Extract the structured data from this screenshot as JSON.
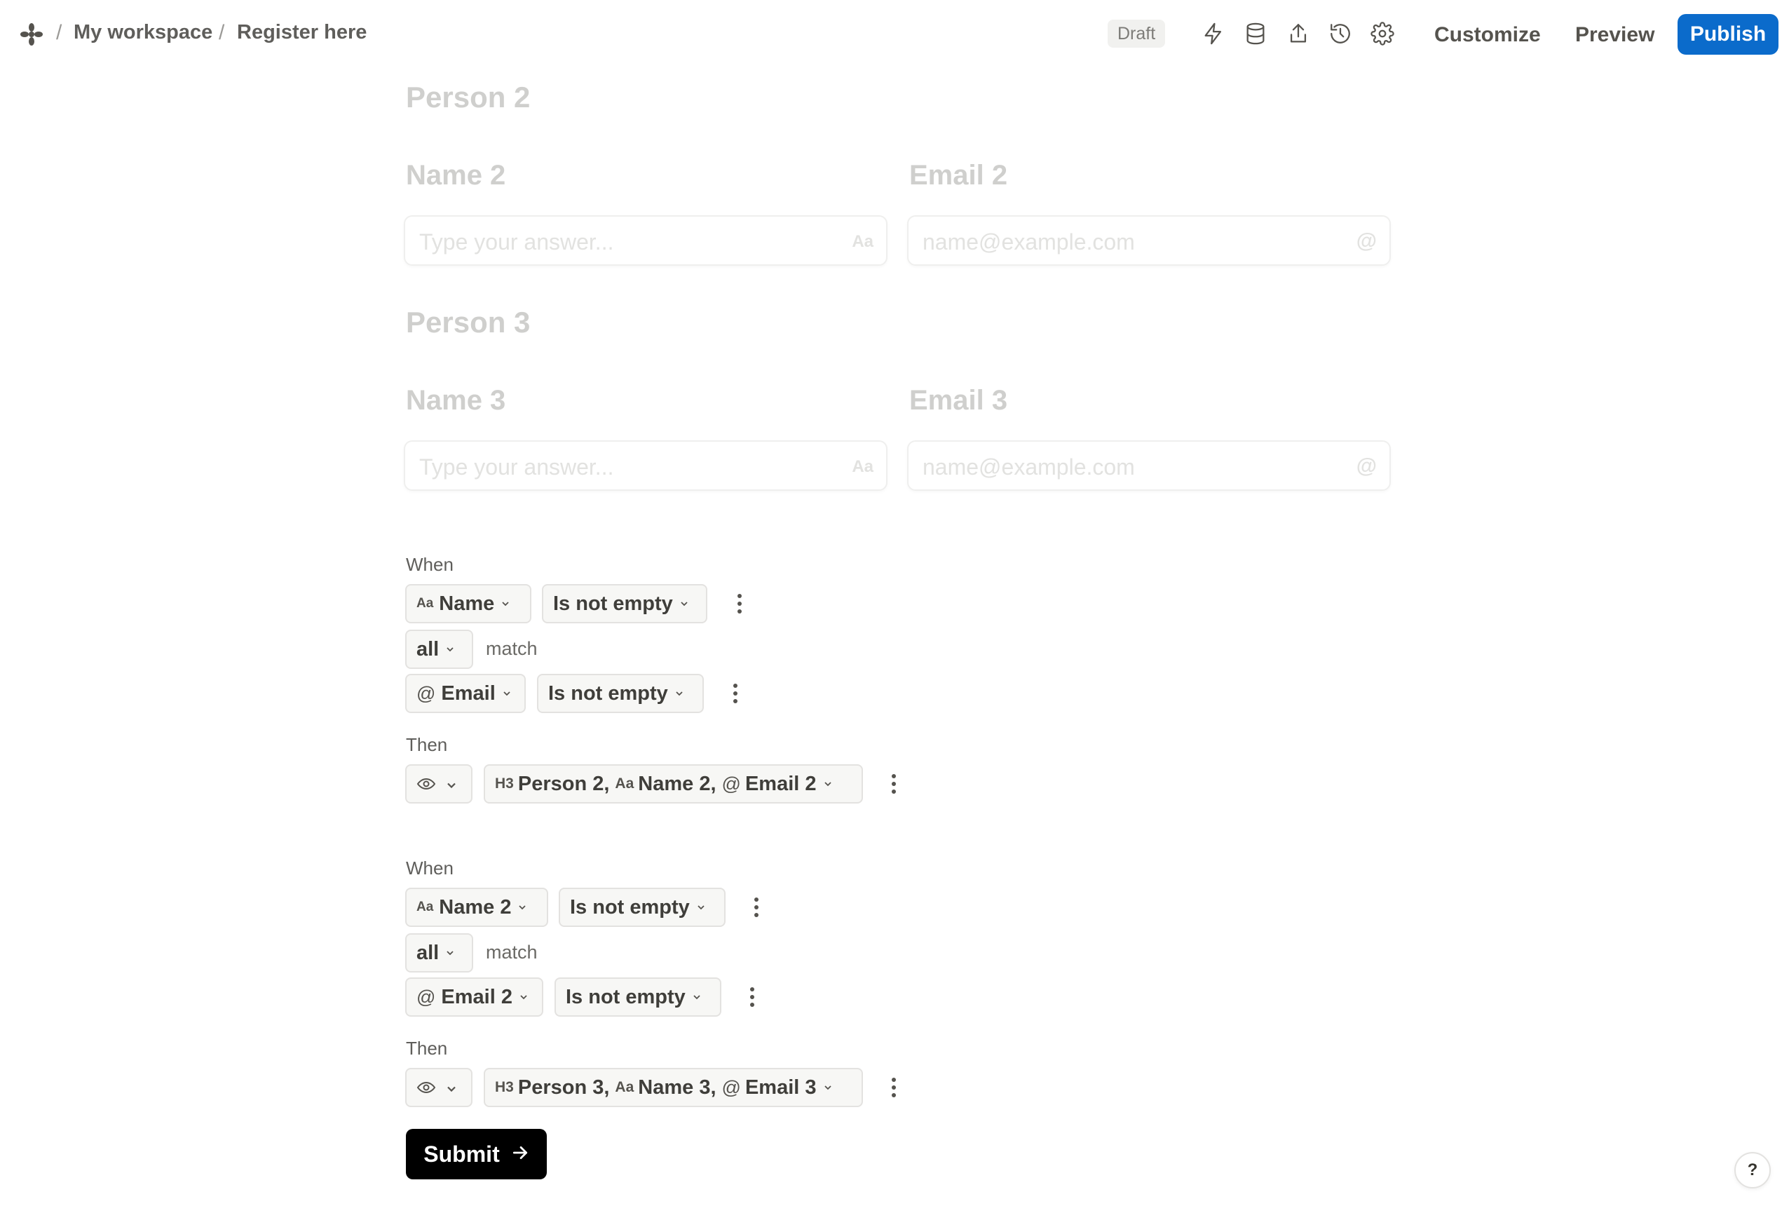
{
  "breadcrumb": {
    "workspace": "My workspace",
    "page": "Register here",
    "separator": "/"
  },
  "toolbar": {
    "status_badge": "Draft",
    "icons": [
      "lightning-icon",
      "database-icon",
      "share-icon",
      "history-icon",
      "settings-icon"
    ],
    "customize_label": "Customize",
    "preview_label": "Preview",
    "publish_label": "Publish",
    "accent_color": "#0b6bcb"
  },
  "form": {
    "sections": [
      {
        "heading": "Person 2",
        "name_label": "Name 2",
        "name_placeholder": "Type your answer...",
        "email_label": "Email 2",
        "email_placeholder": "name@example.com"
      },
      {
        "heading": "Person 3",
        "name_label": "Name 3",
        "name_placeholder": "Type your answer...",
        "email_label": "Email 3",
        "email_placeholder": "name@example.com"
      }
    ],
    "text_suffix": "Aa",
    "email_suffix": "@"
  },
  "logic": [
    {
      "when_label": "When",
      "condition1": {
        "field": "Name",
        "operator": "Is not empty"
      },
      "match_mode": "all",
      "match_text": "match",
      "condition2": {
        "field": "Email",
        "operator": "Is not empty"
      },
      "then_label": "Then",
      "targets": {
        "heading": "Person 2,",
        "name": "Name 2,",
        "email": "Email 2"
      }
    },
    {
      "when_label": "When",
      "condition1": {
        "field": "Name 2",
        "operator": "Is not empty"
      },
      "match_mode": "all",
      "match_text": "match",
      "condition2": {
        "field": "Email 2",
        "operator": "Is not empty"
      },
      "then_label": "Then",
      "targets": {
        "heading": "Person 3,",
        "name": "Name 3,",
        "email": "Email 3"
      }
    }
  ],
  "field_prefixes": {
    "text": "Aa",
    "email": "@",
    "heading": "H3"
  },
  "submit_label": "Submit",
  "help_label": "?"
}
